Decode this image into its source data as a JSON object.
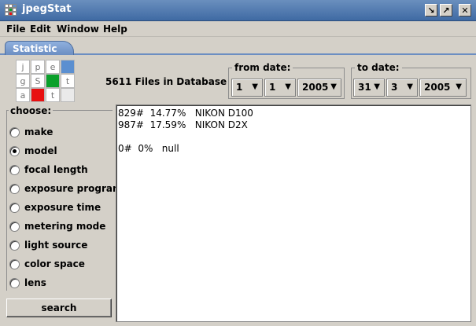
{
  "window": {
    "title": "jpegStat"
  },
  "menu": [
    "File",
    "Edit",
    "Window",
    "Help"
  ],
  "tabs": [
    {
      "label": "Statistic",
      "active": true
    }
  ],
  "logo": {
    "cells": [
      "j",
      "p",
      "e",
      "",
      "g",
      "S",
      "",
      "t",
      "a",
      "",
      "t",
      ""
    ]
  },
  "colors": {
    "accent": "#6c8ec2",
    "logo_blue": "#5b8fd0",
    "logo_green": "#0aa02a",
    "logo_red": "#e81010"
  },
  "database": {
    "files_label": "5611 Files in Database"
  },
  "from_date": {
    "label": "from date:",
    "day": "1",
    "month": "1",
    "year": "2005"
  },
  "to_date": {
    "label": "to date:",
    "day": "31",
    "month": "3",
    "year": "2005"
  },
  "choose": {
    "label": "choose:",
    "options": [
      {
        "label": "make",
        "selected": false
      },
      {
        "label": "model",
        "selected": true
      },
      {
        "label": "focal length",
        "selected": false
      },
      {
        "label": "exposure program",
        "selected": false
      },
      {
        "label": "exposure time",
        "selected": false
      },
      {
        "label": "metering mode",
        "selected": false
      },
      {
        "label": "light source",
        "selected": false
      },
      {
        "label": "color space",
        "selected": false
      },
      {
        "label": "lens",
        "selected": false
      }
    ]
  },
  "search_button": {
    "label": "search"
  },
  "results": [
    "829#  14.77%   NIKON D100",
    "987#  17.59%   NIKON D2X",
    "0#  0%   null"
  ]
}
